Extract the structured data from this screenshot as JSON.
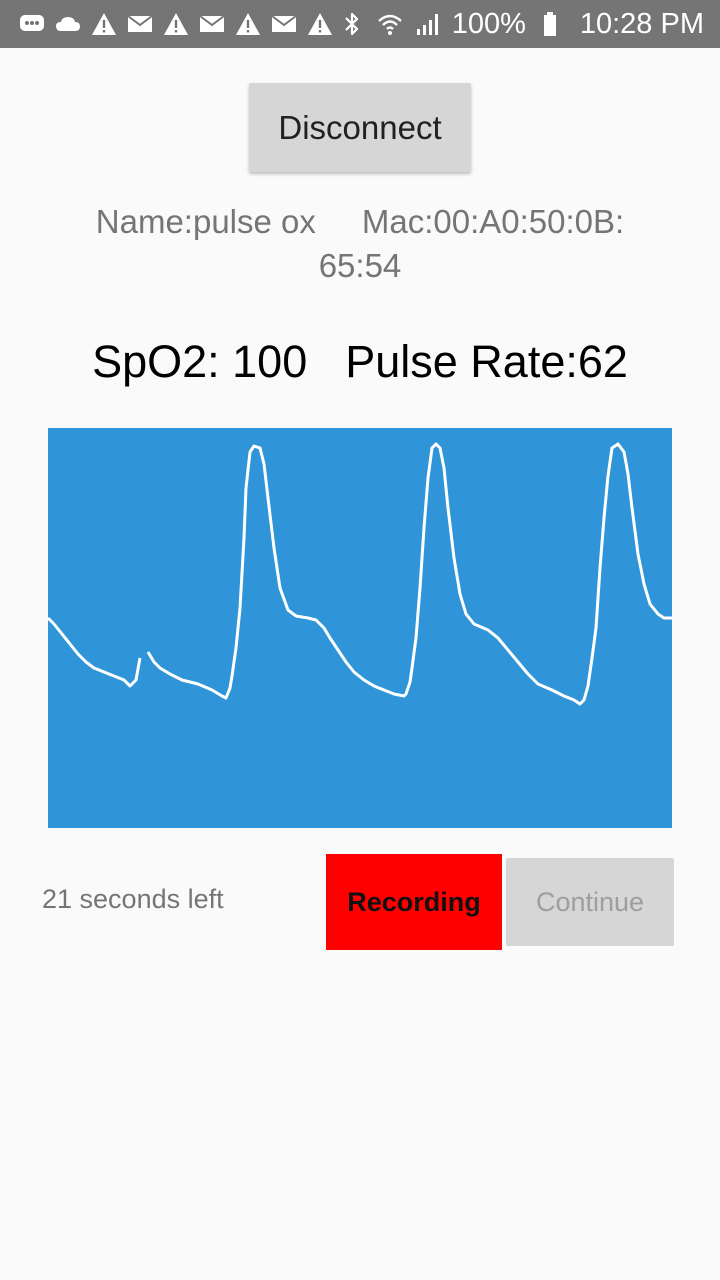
{
  "status_bar": {
    "notification_icons": [
      "message-icon",
      "cloud-icon",
      "warning-icon",
      "mail-icon",
      "warning-icon",
      "mail-icon",
      "warning-icon",
      "mail-icon",
      "warning-icon"
    ],
    "system_icons": [
      "bluetooth-icon",
      "wifi-icon",
      "signal-icon"
    ],
    "battery": "100%",
    "time": "10:28 PM"
  },
  "disconnect_label": "Disconnect",
  "device": {
    "name": "Name:pulse ox",
    "mac": "Mac:00:A0:50:0B:",
    "mac_cont": "65:54"
  },
  "vitals": {
    "spo2": "SpO2: 100",
    "pulse_rate": "Pulse Rate:62"
  },
  "waveform": {
    "background_color": "#2f95d8",
    "line_color": "#ffffff"
  },
  "countdown": "21 seconds left",
  "recording_label": "Recording",
  "recording_color": "#ff0000",
  "continue_label": "Continue"
}
